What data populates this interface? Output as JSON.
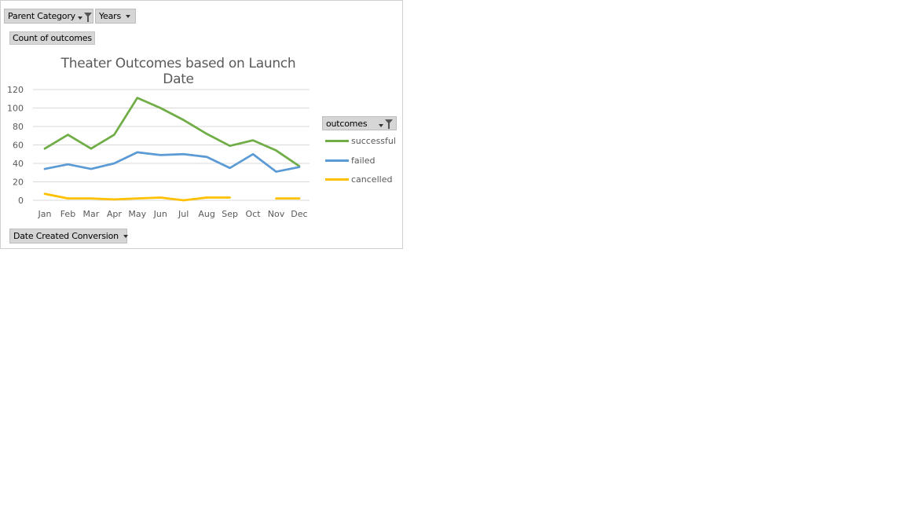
{
  "filters": {
    "parent_category": "Parent Category",
    "years": "Years"
  },
  "value_field": "Count of outcomes",
  "axis_field": "Date Created Conversion",
  "legend_field": "outcomes",
  "colors": {
    "successful": "#70ad47",
    "failed": "#5b9bd5",
    "cancelled": "#ffc000"
  },
  "chart_data": {
    "type": "line",
    "title": "Theater Outcomes based on Launch Date",
    "categories": [
      "Jan",
      "Feb",
      "Mar",
      "Apr",
      "May",
      "Jun",
      "Jul",
      "Aug",
      "Sep",
      "Oct",
      "Nov",
      "Dec"
    ],
    "ylim": [
      0,
      120
    ],
    "yticks": [
      0,
      20,
      40,
      60,
      80,
      100,
      120
    ],
    "grid": true,
    "legend_position": "right",
    "series": [
      {
        "name": "successful",
        "values": [
          56,
          71,
          56,
          71,
          111,
          100,
          87,
          72,
          59,
          65,
          54,
          37
        ]
      },
      {
        "name": "failed",
        "values": [
          34,
          39,
          34,
          40,
          52,
          49,
          50,
          47,
          35,
          50,
          31,
          36
        ]
      },
      {
        "name": "cancelled",
        "values": [
          7,
          2,
          2,
          1,
          2,
          3,
          0,
          3,
          3,
          null,
          2,
          2
        ]
      }
    ]
  }
}
